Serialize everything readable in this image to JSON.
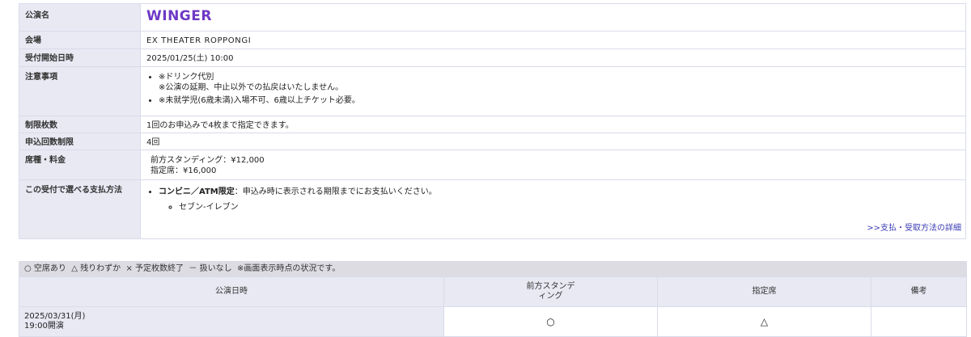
{
  "info": {
    "title_label": "公演名",
    "title_value": "WINGER",
    "venue_label": "会場",
    "venue_value": "EX THEATER ROPPONGI",
    "start_label": "受付開始日時",
    "start_value": "2025/01/25(土) 10:00",
    "notes_label": "注意事項",
    "notes": [
      {
        "line1": "※ドリンク代別",
        "line2": "※公演の延期、中止以外での払戻はいたしません。"
      },
      {
        "line1": "※未就学児(6歳未満)入場不可、6歳以上チケット必要。",
        "line2": ""
      }
    ],
    "limit_label": "制限枚数",
    "limit_value": "1回のお申込みで4枚まで指定できます。",
    "count_label": "申込回数制限",
    "count_value": "4回",
    "seat_label": "席種・料金",
    "seat_lines": [
      "前方スタンディング：¥12,000",
      "指定席：¥16,000"
    ],
    "pay_label": "この受付で選べる支払方法",
    "pay_method": "コンビニ／ATM限定",
    "pay_desc": "：申込み時に表示される期限までにお支払いください。",
    "pay_store": "セブン-イレブン",
    "pay_link": ">>支払・受取方法の詳細"
  },
  "availability": {
    "legend": "○ 空席あり  △ 残りわずか  × 予定枚数終了  － 扱いなし  ※画面表示時点の状況です。",
    "headers": [
      "公演日時",
      "前方スタンデ\nィング",
      "指定席",
      "備考"
    ],
    "rows": [
      {
        "date_line1": "2025/03/31(月)",
        "date_line2": "19:00開演",
        "standing": "○",
        "reserved": "△",
        "note": ""
      }
    ]
  }
}
